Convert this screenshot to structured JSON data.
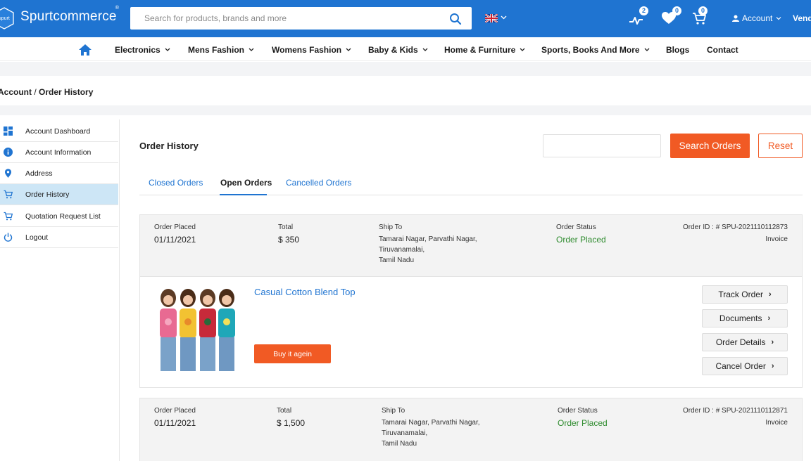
{
  "header": {
    "brand": "Spurtcommerce",
    "brand_mark": "®",
    "search_placeholder": "Search for products, brands and more",
    "compare_count": "2",
    "wishlist_count": "0",
    "cart_count": "0",
    "account_label": "Account",
    "vendor_label": "Vend",
    "colors": {
      "primary": "#1f74d1",
      "accent": "#f15a24",
      "success": "#2e8b2e"
    }
  },
  "nav": {
    "items": [
      {
        "label": "Electronics",
        "dropdown": true
      },
      {
        "label": "Mens Fashion",
        "dropdown": true
      },
      {
        "label": "Womens Fashion",
        "dropdown": true
      },
      {
        "label": "Baby & Kids",
        "dropdown": true
      },
      {
        "label": "Home & Furniture",
        "dropdown": true
      },
      {
        "label": "Sports, Books And More",
        "dropdown": true
      },
      {
        "label": "Blogs",
        "dropdown": false
      },
      {
        "label": "Contact",
        "dropdown": false
      }
    ]
  },
  "breadcrumb": {
    "parent": "Account",
    "separator": " / ",
    "current": "Order History"
  },
  "sidebar": {
    "items": [
      {
        "label": "Account Dashboard",
        "icon": "dashboard-icon"
      },
      {
        "label": "Account Information",
        "icon": "info-icon"
      },
      {
        "label": "Address",
        "icon": "location-pin-icon"
      },
      {
        "label": "Order History",
        "icon": "cart-icon",
        "active": true
      },
      {
        "label": "Quotation Request List",
        "icon": "cart-icon"
      },
      {
        "label": "Logout",
        "icon": "power-icon"
      }
    ]
  },
  "main": {
    "title": "Order History",
    "search_value": "",
    "search_button": "Search Orders",
    "reset_button": "Reset",
    "tabs": [
      {
        "label": "Closed Orders"
      },
      {
        "label": "Open Orders",
        "active": true
      },
      {
        "label": "Cancelled Orders"
      }
    ],
    "labels": {
      "placed": "Order Placed",
      "total": "Total",
      "ship_to": "Ship To",
      "status": "Order Status",
      "invoice": "Invoice"
    },
    "orders": [
      {
        "date": "01/11/2021",
        "total": "$ 350",
        "ship_line1": "Tamarai Nagar, Parvathi Nagar,",
        "ship_line2": "Tiruvanamalai,",
        "ship_line3": "Tamil Nadu",
        "status": "Order Placed",
        "order_id": "Order ID : # SPU-2021110112873",
        "product": {
          "name": "Casual Cotton Blend Top",
          "buy_again": "Buy it agein",
          "actions": [
            "Track Order",
            "Documents",
            "Order Details",
            "Cancel Order"
          ]
        }
      },
      {
        "date": "01/11/2021",
        "total": "$ 1,500",
        "ship_line1": "Tamarai Nagar, Parvathi Nagar,",
        "ship_line2": "Tiruvanamalai,",
        "ship_line3": "Tamil Nadu",
        "status": "Order Placed",
        "order_id": "Order ID : # SPU-2021110112871"
      }
    ]
  }
}
